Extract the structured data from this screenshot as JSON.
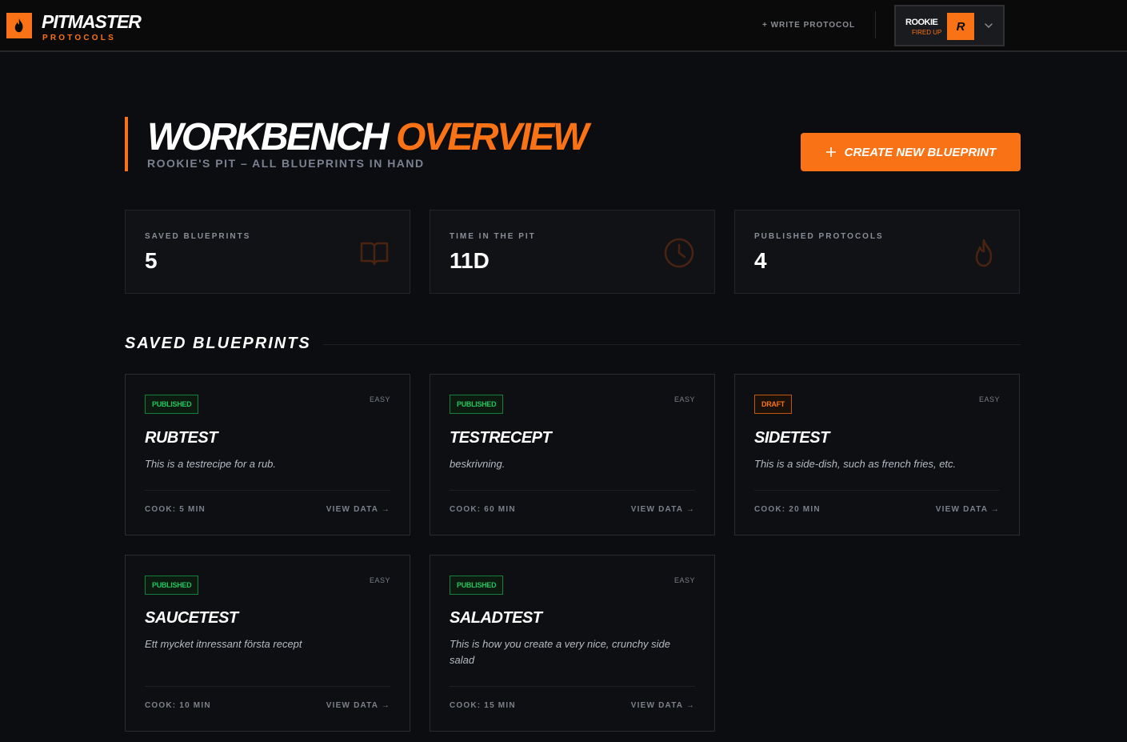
{
  "brand": {
    "title": "PITMASTER",
    "subtitle": "PROTOCOLS"
  },
  "nav": {
    "write_protocol": "+ WRITE PROTOCOL"
  },
  "user": {
    "name": "ROOKIE",
    "status": "FIRED UP",
    "avatar_letter": "R"
  },
  "header": {
    "title_part1": "WORKBENCH",
    "title_part2": "OVERVIEW",
    "subtitle": "ROOKIE'S PIT – ALL BLUEPRINTS IN HAND",
    "create_button": "CREATE NEW BLUEPRINT"
  },
  "stats": [
    {
      "label": "SAVED BLUEPRINTS",
      "value": "5",
      "icon": "book-icon"
    },
    {
      "label": "TIME IN THE PIT",
      "value": "11D",
      "icon": "clock-icon"
    },
    {
      "label": "PUBLISHED PROTOCOLS",
      "value": "4",
      "icon": "flame-icon"
    }
  ],
  "section": {
    "title": "SAVED BLUEPRINTS"
  },
  "blueprints": [
    {
      "status": "PUBLISHED",
      "difficulty": "EASY",
      "title": "RUBTEST",
      "description": "This is a testrecipe for a rub.",
      "cook": "COOK: 5 MIN",
      "view": "VIEW DATA →"
    },
    {
      "status": "PUBLISHED",
      "difficulty": "EASY",
      "title": "TESTRECEPT",
      "description": "beskrivning.",
      "cook": "COOK: 60 MIN",
      "view": "VIEW DATA →"
    },
    {
      "status": "DRAFT",
      "difficulty": "EASY",
      "title": "SIDETEST",
      "description": "This is a side-dish, such as french fries, etc.",
      "cook": "COOK: 20 MIN",
      "view": "VIEW DATA →"
    },
    {
      "status": "PUBLISHED",
      "difficulty": "EASY",
      "title": "SAUCETEST",
      "description": "Ett mycket itnressant första recept",
      "cook": "COOK: 10 MIN",
      "view": "VIEW DATA →"
    },
    {
      "status": "PUBLISHED",
      "difficulty": "EASY",
      "title": "SALADTEST",
      "description": "This is how you create a very nice, crunchy side salad",
      "cook": "COOK: 15 MIN",
      "view": "VIEW DATA →"
    }
  ],
  "colors": {
    "accent": "#f97316",
    "published": "#22c55e",
    "background": "#0c0d10"
  }
}
